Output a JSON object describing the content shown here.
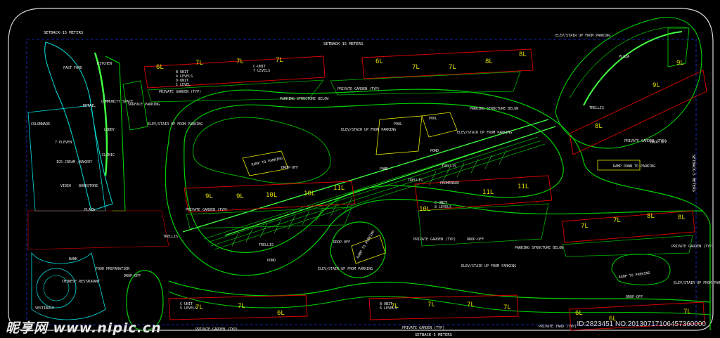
{
  "setbacks": {
    "top": "SETBACK-15 METERS",
    "left": "SETBACK-15 METERS",
    "right": "SETBACK-5 METERS",
    "bottom": "SETBACK-5 METERS"
  },
  "labels": {
    "fast_food": "FAST FOOD",
    "kitchen": "KITCHEN",
    "retail": "RETAIL",
    "community": "COMMUNITY SPACE",
    "lobby": "LOBBY",
    "colonnade": "COLONNADE",
    "seven_eleven": "7-ELEVEN",
    "ice_cream": "ICE-CREAM /BAKERY",
    "clinic": "CLINIC",
    "video": "VIDEO",
    "bookstore": "BOOKSTORE",
    "plaza": "PLAZA",
    "food_prep": "FOOD PREPARATION",
    "bank": "BANK",
    "chinese": "CHINESE RESTAURANT",
    "vestibule": "VESTIBULE",
    "surface_parking": "SURFACE PARKING",
    "pond": "POND",
    "pool": "POOL",
    "trellis": "TRELLIS",
    "promenade": "PROMENADE",
    "drop_off": "DROP-OFF",
    "parking_below": "PARKING STRUCTURE BELOW",
    "elev_stair": "ELEV/STAIR UP FROM PARKING",
    "private_garden": "PRIVATE GARDEN (TYP)",
    "private_yard": "PRIVATE YARD (TYP)",
    "ramp_parking": "RAMP TO PARKING",
    "ramp_down": "RAMP DOWN TO PARKING"
  },
  "units": {
    "b": "B-UNIT",
    "c": "C-UNIT",
    "d": "D-UNIT",
    "lv4": "4 LEVELS",
    "lv5": "5 LEVELS",
    "lv6": "6 LEVELS",
    "lv7": "7 LEVELS",
    "lv8": "8 LEVELS",
    "lv1": "1 LEVEL"
  },
  "building_heights": {
    "top_left": [
      "6L",
      "7L",
      "7L",
      "7L"
    ],
    "top_middle": [
      "6L",
      "7L",
      "7L",
      "8L",
      "8L"
    ],
    "mid_left": [
      "9L",
      "9L",
      "10L",
      "10L",
      "11L"
    ],
    "mid_right": [
      "10L",
      "11L",
      "11L"
    ],
    "plaza_right": [
      "9L",
      "9L",
      "8L"
    ],
    "right_middle": [
      "7L",
      "7L",
      "8L",
      "8L"
    ],
    "bottom_left": [
      "7L",
      "7L",
      "6L"
    ],
    "bottom_middle": [
      "7L",
      "7L",
      "7L",
      "7L"
    ],
    "bottom_right": [
      "6L",
      "6L",
      "7L"
    ]
  },
  "watermark": {
    "site": "昵享网 www.nipic.cn",
    "id": "ID:2823451 NO:20130717106457360000"
  },
  "colors": {
    "background": "#000000",
    "green": "#00e000",
    "bright_green": "#40ff40",
    "cyan": "#00e0e0",
    "yellow": "#e8e800",
    "red": "#e00000",
    "blue": "#3040ff",
    "white": "#ffffff",
    "magenta": "#e000e0"
  }
}
